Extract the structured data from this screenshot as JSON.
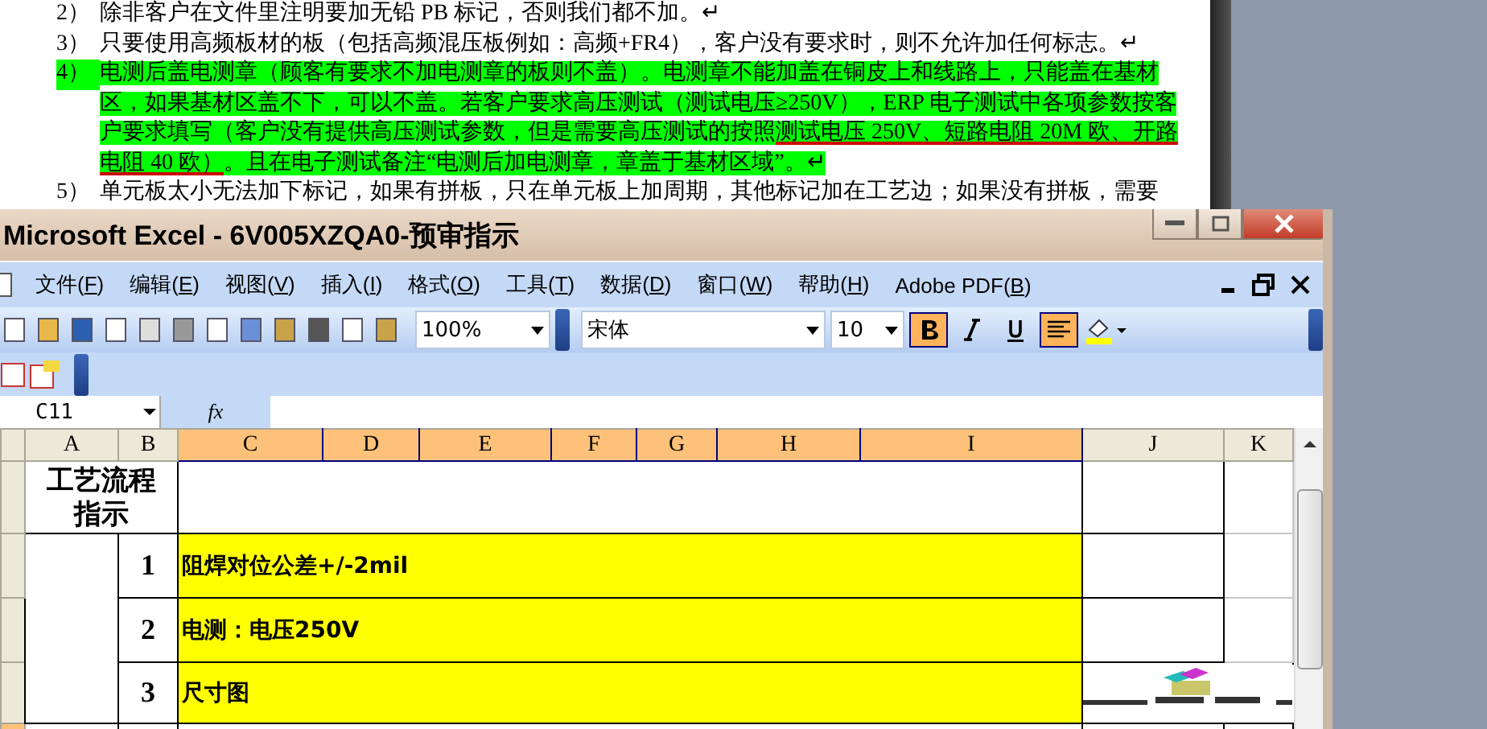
{
  "document": {
    "items": [
      {
        "number": "2）",
        "highlighted": false,
        "runs": [
          {
            "text": "除非客户在文件里注明要加无铅 PB 标记，否则我们都不加。↵",
            "underlined": false
          }
        ]
      },
      {
        "number": "3）",
        "highlighted": false,
        "runs": [
          {
            "text": "只要使用高频板材的板（包括高频混压板例如：高频+FR4），客户没有要求时，则不允许加任何标志。↵",
            "underlined": false
          }
        ]
      },
      {
        "number": "4）",
        "highlighted": true,
        "runs": [
          {
            "text": "电测后盖电测章（顾客有要求不加电测章的板则不盖）。电测章不能加盖在铜皮上和线路上，只能盖在基材区，如果基材区盖不下，可以不盖。若客户要求高压测试（测试电压≥250V），ERP 电子测试中各项参数按客户要求填写（客户没有提供高压测试参数，但是需要高压测试的按照",
            "underlined": false
          },
          {
            "text": "测试电压 250V、短路电阻 20M 欧、开路电阻 40 欧）",
            "underlined": true
          },
          {
            "text": "。且在电子测试备注“电测后加电测章，章盖于基材区域”。",
            "underlined": false
          },
          {
            "text": "↵",
            "underlined": false
          }
        ]
      },
      {
        "number": "5）",
        "highlighted": false,
        "runs": [
          {
            "text": "单元板太小无法加下标记，如果有拼板，只在单元板上加周期，其他标记加在工艺边；如果没有拼板，需要",
            "underlined": false
          }
        ]
      }
    ]
  },
  "excel": {
    "title": "Microsoft Excel - 6V005XZQA0-预审指示",
    "menu": [
      {
        "before": "文件(",
        "key": "F",
        "after": ")"
      },
      {
        "before": "编辑(",
        "key": "E",
        "after": ")"
      },
      {
        "before": "视图(",
        "key": "V",
        "after": ")"
      },
      {
        "before": "插入(",
        "key": "I",
        "after": ")"
      },
      {
        "before": "格式(",
        "key": "O",
        "after": ")"
      },
      {
        "before": "工具(",
        "key": "T",
        "after": ")"
      },
      {
        "before": "数据(",
        "key": "D",
        "after": ")"
      },
      {
        "before": "窗口(",
        "key": "W",
        "after": ")"
      },
      {
        "before": "帮助(",
        "key": "H",
        "after": ")"
      },
      {
        "before": "Adobe PDF(",
        "key": "B",
        "after": ")"
      }
    ],
    "toolbar": {
      "zoom": "100%",
      "font": "宋体",
      "font_size": "10",
      "bold": true,
      "italic": false,
      "underline": false,
      "align_left": true
    },
    "name_box": "C11",
    "formula_label": "fx",
    "columns": [
      {
        "label": "A",
        "selected": false
      },
      {
        "label": "B",
        "selected": false
      },
      {
        "label": "C",
        "selected": true
      },
      {
        "label": "D",
        "selected": true
      },
      {
        "label": "E",
        "selected": true
      },
      {
        "label": "F",
        "selected": true
      },
      {
        "label": "G",
        "selected": true
      },
      {
        "label": "H",
        "selected": true
      },
      {
        "label": "I",
        "selected": true
      },
      {
        "label": "J",
        "selected": false
      },
      {
        "label": "K",
        "selected": false
      }
    ],
    "title_cell": [
      "工艺流程",
      "指示"
    ],
    "rows": [
      {
        "number": "1",
        "text": "阻焊对位公差+/-2mil",
        "picture": false
      },
      {
        "number": "2",
        "text": "电测：电压250V",
        "picture": false
      },
      {
        "number": "3",
        "text": "尺寸图",
        "picture": true
      }
    ]
  }
}
